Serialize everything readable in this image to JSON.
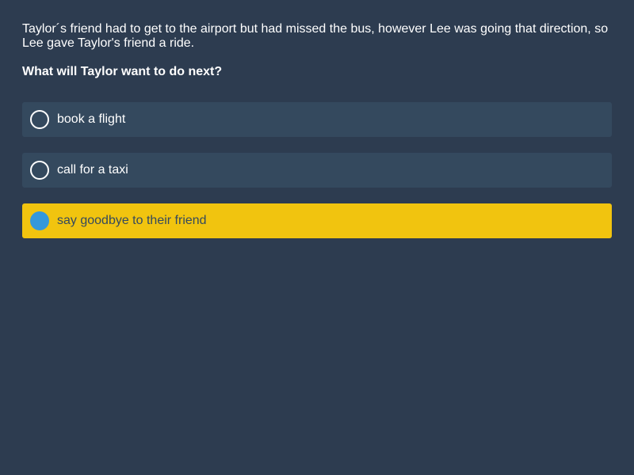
{
  "prompt": {
    "story": "Taylor´s friend had to get to the airport but had missed the bus, however Lee was going that direction, so Lee gave Taylor's friend a ride.",
    "question": "What will Taylor want to do next?"
  },
  "options": [
    {
      "label": "book a flight",
      "selected": false
    },
    {
      "label": "call for a taxi",
      "selected": false
    },
    {
      "label": "say goodbye to their friend",
      "selected": true
    }
  ],
  "colors": {
    "background": "#2d3c50",
    "option_background": "#34495e",
    "selected_background": "#f1c40f",
    "selected_radio": "#3498db",
    "text": "#ffffff"
  }
}
